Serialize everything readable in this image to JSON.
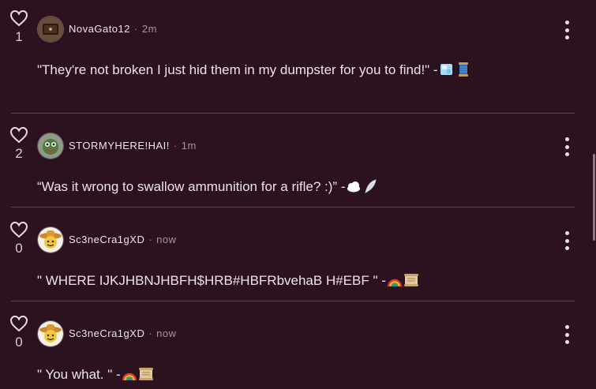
{
  "comments": [
    {
      "likes": "1",
      "username": "NovaGato12",
      "separator": "·",
      "time": "2m",
      "text": "\"They're not broken I just hid them in my dumpster for you to find!\" -",
      "emojis": [
        "ice-cube-emoji",
        "thread-spool-emoji"
      ],
      "avatar": "dark-box-avatar"
    },
    {
      "likes": "2",
      "username": "STORMYHERE!HAI!",
      "separator": "·",
      "time": "1m",
      "text": "“Was it wrong to swallow ammunition for a rifle? :)” -",
      "emojis": [
        "cloud-emoji",
        "wing-emoji"
      ],
      "avatar": "green-creature-avatar"
    },
    {
      "likes": "0",
      "username": "Sc3neCra1gXD",
      "separator": "·",
      "time": "now",
      "text": "\" WHERE IJKJHBNJHBFH$HRB#HBFRbvehaB H#EBF \" -",
      "emojis": [
        "rainbow-emoji",
        "scroll-emoji"
      ],
      "avatar": "sombrero-smiley-avatar"
    },
    {
      "likes": "0",
      "username": "Sc3neCra1gXD",
      "separator": "·",
      "time": "now",
      "text": "\" You what. \" -",
      "emojis": [
        "rainbow-emoji",
        "scroll-emoji"
      ],
      "avatar": "sombrero-smiley-avatar"
    }
  ],
  "colors": {
    "background": "#2c121e",
    "divider": "#5a4350",
    "text": "#ece4e8",
    "muted": "#a8969f"
  }
}
